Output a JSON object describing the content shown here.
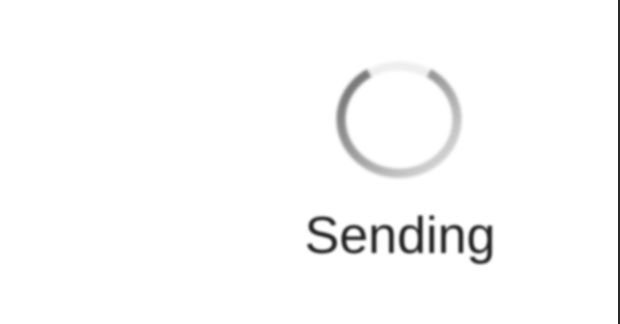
{
  "status": {
    "label": "Sending",
    "icon": "loading-spinner-icon"
  },
  "colors": {
    "background": "#ffffff",
    "text": "#1f1f1f",
    "spinner_track": "#e0e0e0",
    "spinner_arc_dark": "#7a7a7a",
    "spinner_arc_light": "#d8d8d8",
    "edge": "#2b2b2b"
  }
}
